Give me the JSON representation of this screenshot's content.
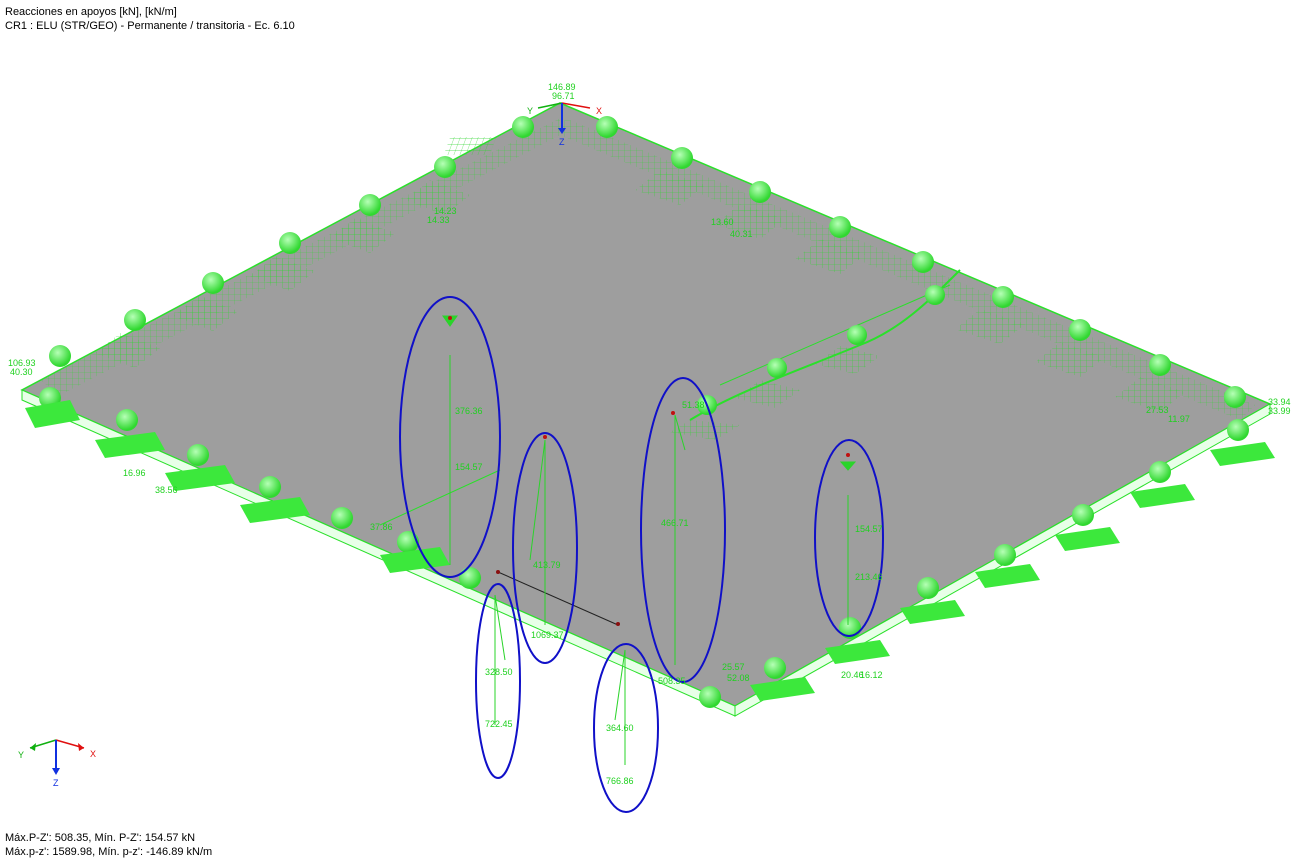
{
  "header": {
    "title": "Reacciones en apoyos [kN], [kN/m]",
    "load_combo": "CR1 : ELU (STR/GEO) - Permanente / transitoria - Ec. 6.10"
  },
  "footer": {
    "line1": "Máx.P-Z': 508.35, Mín. P-Z': 154.57 kN",
    "line2": "Máx.p-z': 1589.98, Mín. p-z': -146.89 kN/m"
  },
  "axes": {
    "x": "X",
    "y": "Y",
    "z": "Z"
  },
  "labels": {
    "top_corner_1": "146.89",
    "top_corner_2": "96.71",
    "left_1": "106.93",
    "left_2": "40.30",
    "left_edge_1": "16.96",
    "left_edge_2": "38.56",
    "left_edge_3": "37.86",
    "ridge_left_1": "14.23",
    "ridge_left_2": "14.33",
    "ridge_right_1": "13.60",
    "ridge_right_2": "40.31",
    "right_1": "33.94",
    "right_2": "33.99",
    "right_inner_1": "27.53",
    "right_inner_2": "11.97",
    "col1_a": "376.36",
    "col1_b": "154.57",
    "col2_a": "413.79",
    "col2_b": "1069.37",
    "col3_top": "51.38",
    "col3_a": "466.71",
    "col3_b": "508.35",
    "col4_a": "154.57",
    "col4_b": "213.46",
    "col5_a": "328.50",
    "col5_b": "722.45",
    "col6_a": "364.60",
    "col6_b": "766.86",
    "bottom_1": "25.57",
    "bottom_2": "52.08",
    "bottom_3": "20.46",
    "bottom_4": "16.12"
  },
  "colors": {
    "slab": "#9e9e9e",
    "edge": "#2ae02a",
    "support": "#3bea3b",
    "highlight": "#1010c8",
    "axis_x": "#e01010",
    "axis_y": "#10b010",
    "axis_z": "#1030e0"
  }
}
